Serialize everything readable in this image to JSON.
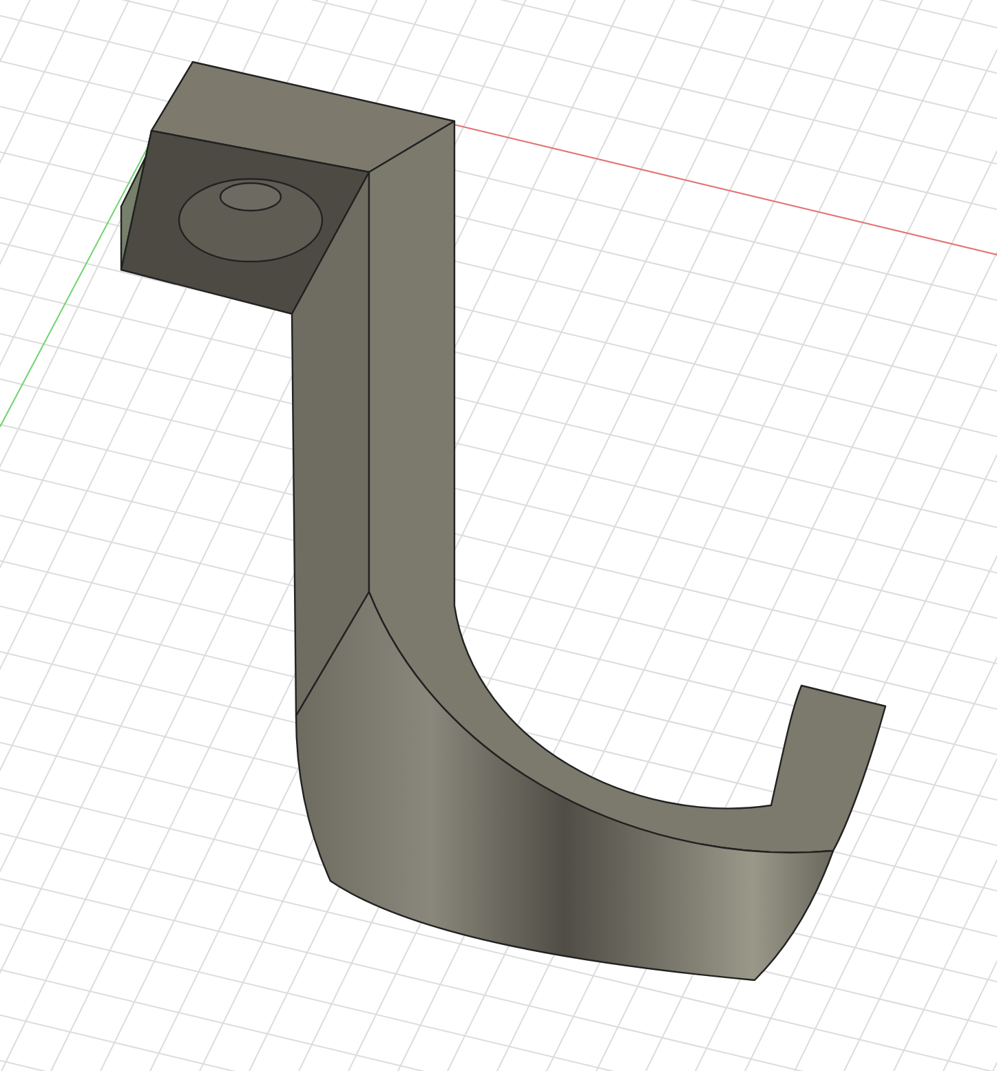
{
  "viewport": {
    "grid": true,
    "axes": [
      {
        "kind": "x",
        "color": "#e8706f"
      },
      {
        "kind": "y",
        "color": "#6fd36f"
      }
    ]
  }
}
